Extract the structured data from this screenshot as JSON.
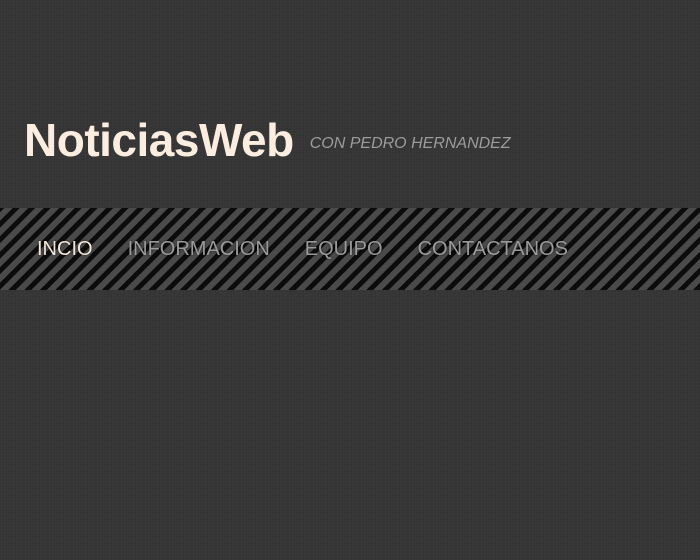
{
  "header": {
    "title": "NoticiasWeb",
    "tagline": "CON PEDRO HERNANDEZ"
  },
  "nav": {
    "items": [
      {
        "label": "INCIO",
        "active": true
      },
      {
        "label": "INFORMACION",
        "active": false
      },
      {
        "label": "EQUIPO",
        "active": false
      },
      {
        "label": "CONTACTANOS",
        "active": false
      }
    ]
  },
  "colors": {
    "background": "#353535",
    "title": "#fbeee0",
    "tagline": "#9c9c9c",
    "nav_active": "#f4e6d8",
    "nav_inactive": "#9a9a9a",
    "stripe_dark": "#0c0c0c",
    "stripe_light": "#4a4a4a"
  }
}
